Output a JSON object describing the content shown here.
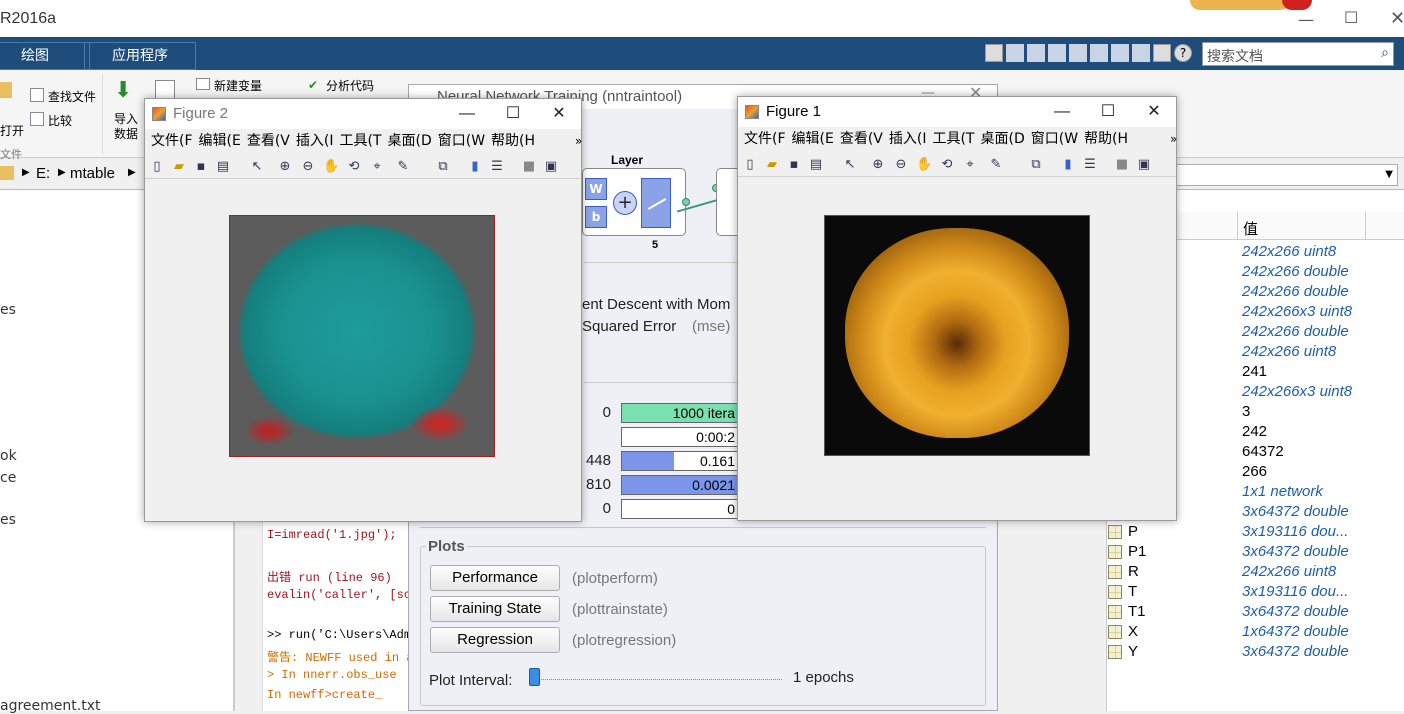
{
  "app": {
    "title": "R2016a"
  },
  "ribbon": {
    "tabs": [
      "绘图",
      "应用程序"
    ],
    "search_placeholder": "搜索文档",
    "items": {
      "find_files": "查找文件",
      "compare": "比较",
      "open": "打开",
      "import": "导入",
      "data": "数据",
      "new_variable": "新建变量",
      "analyze_code": "分析代码",
      "section": "文件"
    }
  },
  "address": {
    "parts": [
      "E:",
      "mtable"
    ]
  },
  "left_panel": {
    "items": [
      "es",
      "ok",
      "ce",
      "es",
      "agreement.txt"
    ]
  },
  "command": {
    "lines": [
      {
        "text": "I=imread('1.jpg');",
        "color": "#a0141e"
      },
      {
        "text": "出错 run (line 96)",
        "color": "#a0141e"
      },
      {
        "text": "evalin('caller', [sc",
        "color": "#a0141e"
      },
      {
        "text": ">> run('C:\\Users\\Adm",
        "color": "#000000"
      },
      {
        "text": "警告: NEWFF used in a",
        "color": "#d06a00"
      },
      {
        "text": "> In nnerr.obs_use",
        "color": "#d06a00"
      },
      {
        "text": "  In newff>create_",
        "color": "#d06a00"
      }
    ]
  },
  "figure2": {
    "title": "Figure 2",
    "menu": [
      "文件(F",
      "编辑(E",
      "查看(V",
      "插入(I",
      "工具(T",
      "桌面(D",
      "窗口(W",
      "帮助(H"
    ]
  },
  "figure1": {
    "title": "Figure 1",
    "menu": [
      "文件(F",
      "编辑(E",
      "查看(V",
      "插入(I",
      "工具(T",
      "桌面(D",
      "窗口(W",
      "帮助(H"
    ]
  },
  "nntraintool": {
    "title": "Neural Network Training (nntraintool)",
    "layer_label": "Layer",
    "w_label": "W",
    "b_label": "b",
    "layer_size": "5",
    "algorithm": "ent Descent with Mom",
    "performance": "Squared Error",
    "performance_fn": "(mse)",
    "progress": [
      {
        "left": "0",
        "value": "1000 itera",
        "fill": 1.0,
        "color": "#7be0b0"
      },
      {
        "left": "",
        "value": "0:00:2",
        "fill": 0.0,
        "color": "#ffffff"
      },
      {
        "left": "448",
        "value": "0.161",
        "fill": 0.45,
        "color": "#7b95e8"
      },
      {
        "left": "810",
        "value": "0.0021",
        "fill": 1.0,
        "color": "#7b95e8"
      },
      {
        "left": "0",
        "value": "0",
        "fill": 0.0,
        "color": "#ffffff"
      }
    ],
    "plots_header": "Plots",
    "plots": [
      {
        "label": "Performance",
        "fn": "(plotperform)"
      },
      {
        "label": "Training State",
        "fn": "(plottrainstate)"
      },
      {
        "label": "Regression",
        "fn": "(plotregression)"
      }
    ],
    "plot_interval_label": "Plot Interval:",
    "plot_interval_value": "1 epochs"
  },
  "workspace": {
    "header": "值",
    "rows": [
      {
        "name": "",
        "value": "242x266 uint8",
        "italic": true
      },
      {
        "name": "",
        "value": "242x266 double",
        "italic": true
      },
      {
        "name": "",
        "value": "242x266 double",
        "italic": true
      },
      {
        "name": "",
        "value": "242x266x3 uint8",
        "italic": true
      },
      {
        "name": "",
        "value": "242x266 double",
        "italic": true
      },
      {
        "name": "",
        "value": "242x266 uint8",
        "italic": true
      },
      {
        "name": "",
        "value": "241",
        "italic": false
      },
      {
        "name": "",
        "value": "242x266x3 uint8",
        "italic": true
      },
      {
        "name": "",
        "value": "3",
        "italic": false
      },
      {
        "name": "",
        "value": "242",
        "italic": false
      },
      {
        "name": "",
        "value": "64372",
        "italic": false
      },
      {
        "name": "",
        "value": "266",
        "italic": false
      },
      {
        "name": "",
        "value": "1x1 network",
        "italic": true
      },
      {
        "name": "",
        "value": "3x64372 double",
        "italic": true
      },
      {
        "name": "P",
        "value": "3x193116 dou...",
        "italic": true
      },
      {
        "name": "P1",
        "value": "3x64372 double",
        "italic": true
      },
      {
        "name": "R",
        "value": "242x266 uint8",
        "italic": true
      },
      {
        "name": "T",
        "value": "3x193116 dou...",
        "italic": true
      },
      {
        "name": "T1",
        "value": "3x64372 double",
        "italic": true
      },
      {
        "name": "X",
        "value": "1x64372 double",
        "italic": true
      },
      {
        "name": "Y",
        "value": "3x64372 double",
        "italic": true
      }
    ]
  }
}
